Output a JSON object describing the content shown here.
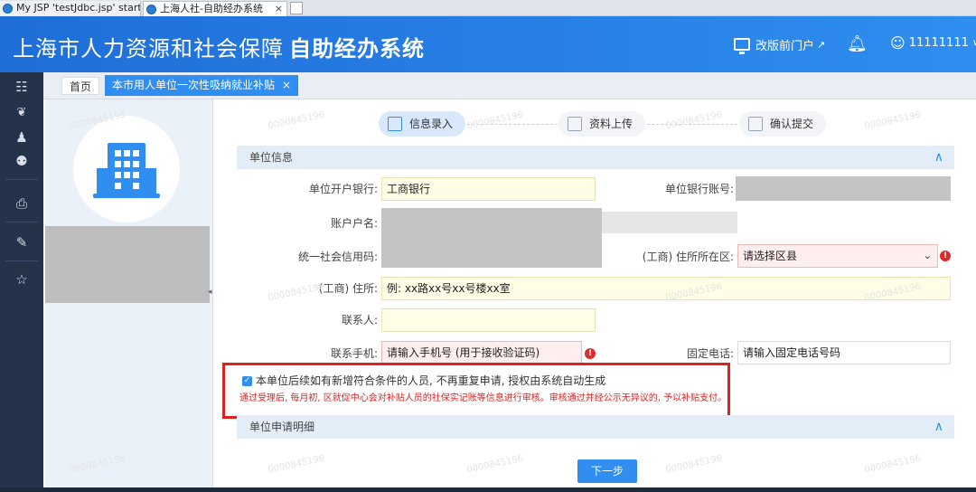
{
  "browser": {
    "tabs": [
      {
        "label": "My JSP 'testJdbc.jsp' startin..."
      },
      {
        "label": "上海人社-自助经办系统"
      }
    ],
    "close_glyph": "×"
  },
  "header": {
    "title_main": "上海市人力资源和社会保障",
    "title_bold": "自助经办系统",
    "portal_link": "改版前门户",
    "user": "11111111"
  },
  "sidebar": {
    "items": [
      {
        "icon": "apps-grid-icon"
      },
      {
        "icon": "handshake-icon"
      },
      {
        "icon": "person-icon"
      },
      {
        "icon": "people-icon"
      },
      {
        "icon": "printer-icon"
      },
      {
        "icon": "document-edit-icon"
      },
      {
        "icon": "star-icon"
      }
    ]
  },
  "crumbs": {
    "home": "首页",
    "active": "本市用人单位一次性吸纳就业补贴",
    "close": "×"
  },
  "steps": [
    {
      "label": "信息录入",
      "state": "active"
    },
    {
      "label": "资料上传",
      "state": "idle"
    },
    {
      "label": "确认提交",
      "state": "idle"
    }
  ],
  "unit_info": {
    "section_title": "单位信息",
    "fields": {
      "bank_label": "单位开户银行:",
      "bank_value": "工商银行",
      "account_label": "单位银行账号:",
      "holder_label": "账户户名:",
      "credit_label": "统一社会信用码:",
      "district_label": "(工商) 住所所在区:",
      "district_value": "请选择区县",
      "address_label": "(工商) 住所:",
      "address_placeholder": "例: xx路xx号xx号楼xx室",
      "contact_label": "联系人:",
      "mobile_label": "联系手机:",
      "mobile_placeholder": "请输入手机号 (用于接收验证码)",
      "phone_label": "固定电话:",
      "phone_placeholder": "请输入固定电话号码"
    }
  },
  "notice": {
    "checkbox_label": "本单位后续如有新增符合条件的人员, 不再重复申请, 授权由系统自动生成",
    "checked": true,
    "warning": "通过受理后, 每月初, 区就促中心会对补贴人员的社保实记账等信息进行审核。审核通过并经公示无异议的, 予以补贴支付。"
  },
  "detail": {
    "section_title": "单位申请明细"
  },
  "next_button": "下一步",
  "watermark": "0000845196",
  "colors": {
    "header_blue": "#2f8ef0",
    "sidebar_dark": "#24324a",
    "error_red": "#e02020"
  }
}
